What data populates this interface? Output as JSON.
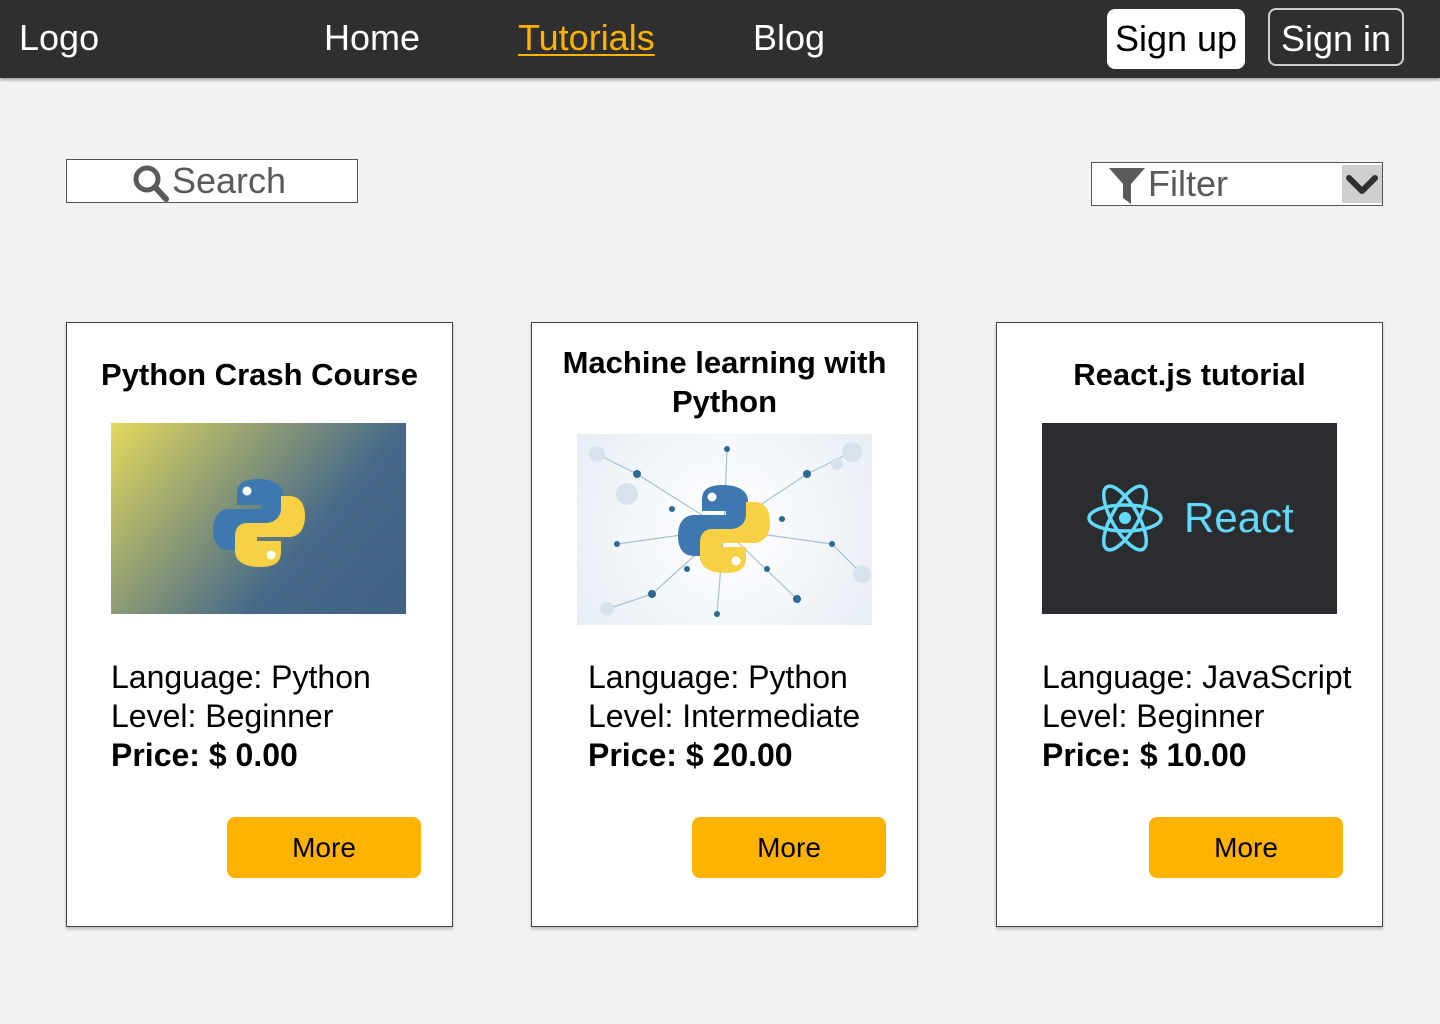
{
  "header": {
    "logo": "Logo",
    "nav": [
      {
        "label": "Home"
      },
      {
        "label": "Tutorials"
      },
      {
        "label": "Blog"
      }
    ],
    "signup": "Sign up",
    "signin": "Sign in",
    "active_color": "#ffb300"
  },
  "search": {
    "placeholder": "Search",
    "icon": "search-icon"
  },
  "filter": {
    "placeholder": "Filter",
    "icon": "funnel-icon",
    "toggle_icon": "chevron-down-icon"
  },
  "cards": [
    {
      "title": "Python Crash Course",
      "image": "python-logo-gradient",
      "language": "Language: Python",
      "level": "Level: Beginner",
      "price": "Price: $ 0.00",
      "button": "More"
    },
    {
      "title": "Machine learning with Python",
      "image": "python-logo-network",
      "language": "Language: Python",
      "level": "Level: Intermediate",
      "price": "Price: $ 20.00",
      "button": "More"
    },
    {
      "title": "React.js tutorial",
      "image": "react-logo",
      "image_text": "React",
      "language": "Language: JavaScript",
      "level": "Level: Beginner",
      "price": "Price: $ 10.00",
      "button": "More"
    }
  ],
  "colors": {
    "header_bg": "#2f2f2f",
    "accent": "#ffb300",
    "page_bg": "#f2f2f2",
    "react_blue": "#61dafb"
  }
}
